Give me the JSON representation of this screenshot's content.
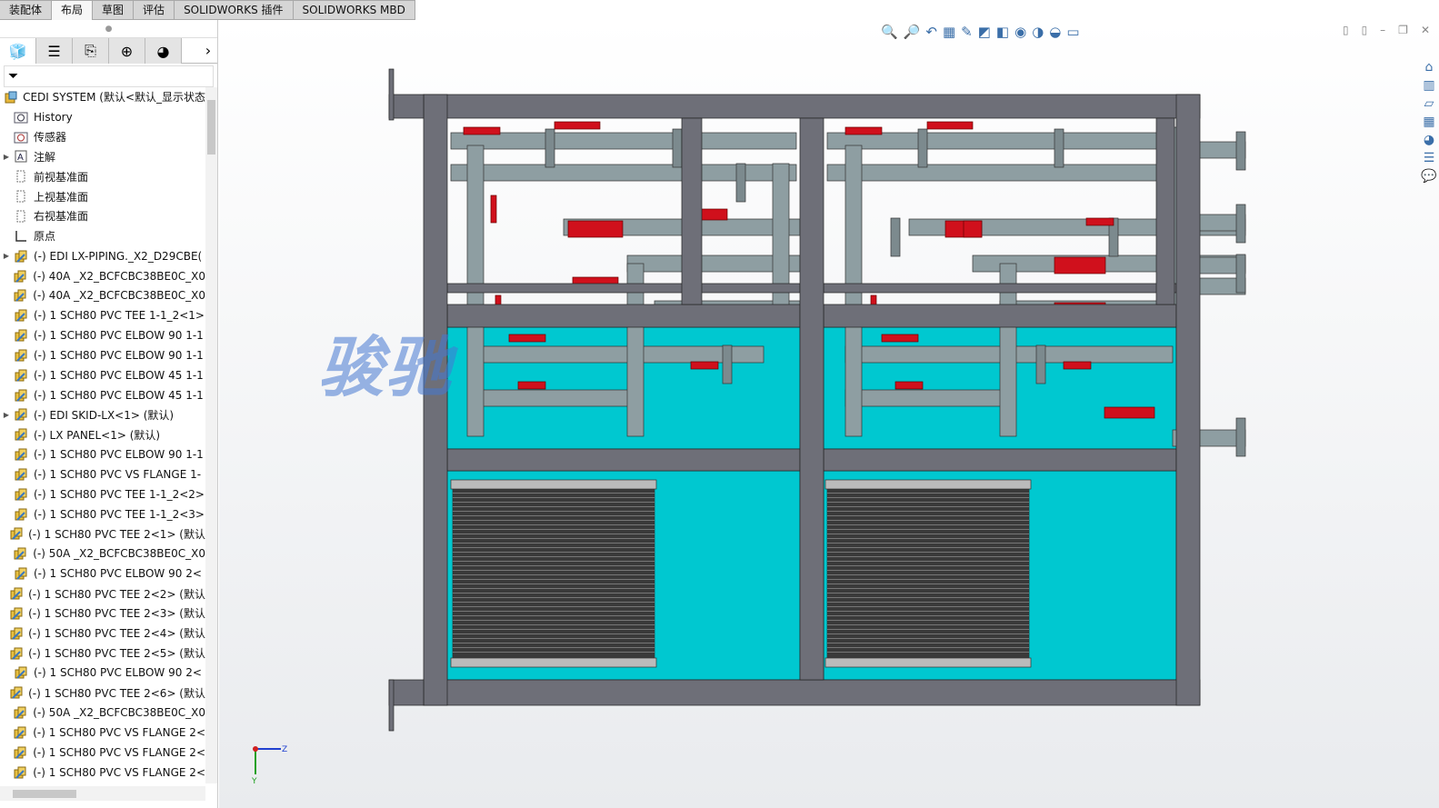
{
  "tabs": [
    {
      "label": "装配体"
    },
    {
      "label": "布局"
    },
    {
      "label": "草图"
    },
    {
      "label": "评估"
    },
    {
      "label": "SOLIDWORKS 插件"
    },
    {
      "label": "SOLIDWORKS MBD"
    }
  ],
  "active_tab": "布局",
  "panel_tabs": [
    "feature-manager-icon",
    "property-manager-icon",
    "configuration-manager-icon",
    "dimxpert-icon",
    "display-manager-icon"
  ],
  "tree": {
    "root": "CEDI SYSTEM  (默认<默认_显示状态",
    "items": [
      {
        "label": "History",
        "icon": "history-folder-icon",
        "expand": false
      },
      {
        "label": "传感器",
        "icon": "sensor-folder-icon",
        "expand": false
      },
      {
        "label": "注解",
        "icon": "annotation-icon",
        "expand": true
      },
      {
        "label": "前视基准面",
        "icon": "plane-icon",
        "expand": false
      },
      {
        "label": "上视基准面",
        "icon": "plane-icon",
        "expand": false
      },
      {
        "label": "右视基准面",
        "icon": "plane-icon",
        "expand": false
      },
      {
        "label": "原点",
        "icon": "origin-icon",
        "expand": false
      },
      {
        "label": "(-) EDI LX-PIPING._X2_D29CBE(",
        "icon": "subassembly-icon",
        "expand": true
      },
      {
        "label": "(-) 40A _X2_BCFCBC38BE0C_X0",
        "icon": "part-icon",
        "expand": false
      },
      {
        "label": "(-) 40A _X2_BCFCBC38BE0C_X0",
        "icon": "part-icon",
        "expand": false
      },
      {
        "label": "(-) 1 SCH80 PVC TEE 1-1_2<1>",
        "icon": "part-icon",
        "expand": false
      },
      {
        "label": "(-) 1 SCH80 PVC ELBOW 90 1-1",
        "icon": "part-icon",
        "expand": false
      },
      {
        "label": "(-) 1 SCH80 PVC ELBOW 90 1-1",
        "icon": "part-icon",
        "expand": false
      },
      {
        "label": "(-) 1 SCH80 PVC ELBOW 45 1-1",
        "icon": "part-icon",
        "expand": false
      },
      {
        "label": "(-) 1 SCH80 PVC ELBOW 45 1-1",
        "icon": "part-icon",
        "expand": false
      },
      {
        "label": "(-) EDI SKID-LX<1> (默认)",
        "icon": "subassembly-icon",
        "expand": true
      },
      {
        "label": "(-) LX PANEL<1> (默认)",
        "icon": "part-icon",
        "expand": false
      },
      {
        "label": "(-) 1 SCH80 PVC ELBOW 90 1-1",
        "icon": "part-icon",
        "expand": false
      },
      {
        "label": "(-) 1 SCH80 PVC VS FLANGE 1-",
        "icon": "part-icon",
        "expand": false
      },
      {
        "label": "(-) 1 SCH80 PVC TEE 1-1_2<2>",
        "icon": "part-icon",
        "expand": false
      },
      {
        "label": "(-) 1 SCH80 PVC TEE 1-1_2<3>",
        "icon": "part-icon",
        "expand": false
      },
      {
        "label": "(-) 1 SCH80 PVC TEE 2<1> (默认",
        "icon": "part-icon",
        "expand": false
      },
      {
        "label": "(-) 50A _X2_BCFCBC38BE0C_X0",
        "icon": "part-icon",
        "expand": false
      },
      {
        "label": "(-) 1 SCH80 PVC ELBOW 90 2<",
        "icon": "part-icon",
        "expand": false
      },
      {
        "label": "(-) 1 SCH80 PVC TEE 2<2> (默认",
        "icon": "part-icon",
        "expand": false
      },
      {
        "label": "(-) 1 SCH80 PVC TEE 2<3> (默认",
        "icon": "part-icon",
        "expand": false
      },
      {
        "label": "(-) 1 SCH80 PVC TEE 2<4> (默认",
        "icon": "part-icon",
        "expand": false
      },
      {
        "label": "(-) 1 SCH80 PVC TEE 2<5> (默认",
        "icon": "part-icon",
        "expand": false
      },
      {
        "label": "(-) 1 SCH80 PVC ELBOW 90 2<",
        "icon": "part-icon",
        "expand": false
      },
      {
        "label": "(-) 1 SCH80 PVC TEE 2<6> (默认",
        "icon": "part-icon",
        "expand": false
      },
      {
        "label": "(-) 50A _X2_BCFCBC38BE0C_X0",
        "icon": "part-icon",
        "expand": false
      },
      {
        "label": "(-) 1 SCH80 PVC VS FLANGE 2<",
        "icon": "part-icon",
        "expand": false
      },
      {
        "label": "(-) 1 SCH80 PVC VS FLANGE 2<",
        "icon": "part-icon",
        "expand": false
      },
      {
        "label": "(-) 1 SCH80 PVC VS FLANGE 2<",
        "icon": "part-icon",
        "expand": false
      }
    ]
  },
  "view": {
    "watermark": "骏驰",
    "triad": {
      "z": "Z",
      "y": "Y"
    },
    "colors": {
      "frame": "#6e6f78",
      "panel": "#00c8d0",
      "pipe": "#8e9ea2",
      "valve": "#d0101c",
      "stack": "#3a3a3a"
    },
    "toolbar_icons": [
      "zoom-to-fit-icon",
      "zoom-area-icon",
      "previous-view-icon",
      "section-view-icon",
      "dynamic-annotation-icon",
      "view-orientation-icon",
      "display-style-icon",
      "hide-show-icon",
      "edit-appearance-icon",
      "scene-icon",
      "view-settings-icon"
    ],
    "right_icons": [
      "home-icon",
      "3d-content-icon",
      "file-explorer-icon",
      "view-palette-icon",
      "appearances-icon",
      "custom-properties-icon",
      "forum-icon"
    ]
  }
}
